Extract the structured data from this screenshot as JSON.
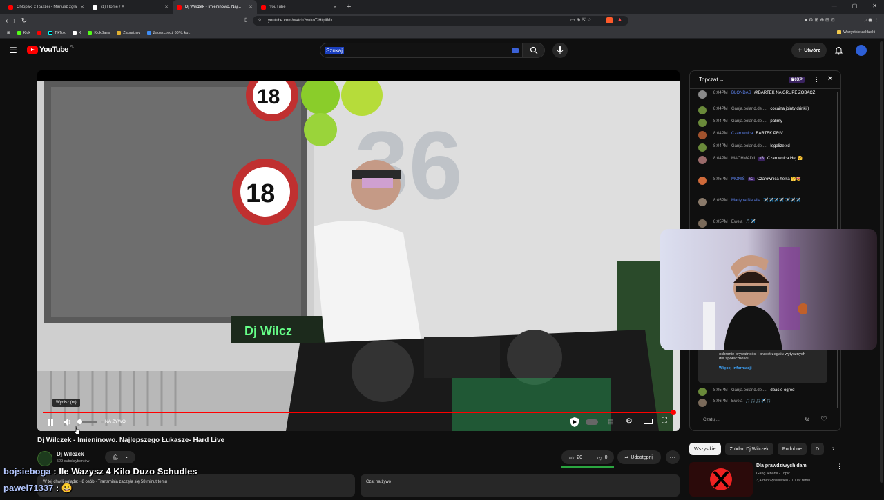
{
  "browser": {
    "tabs": [
      {
        "title": "Chłopaki z Raszei - Mariusz zgłasza ...",
        "fav": "#ff0000",
        "active": false
      },
      {
        "title": "(1) Home / X",
        "fav": "#ffffff",
        "active": false
      },
      {
        "title": "Dj Wilczek - Imieninowo. Naj...",
        "fav": "#ff0000",
        "active": true
      },
      {
        "title": "YouTube",
        "fav": "#ff0000",
        "active": false
      }
    ],
    "url": "youtube.com/watch?v=koT-HtplIMk",
    "bookmarks": [
      "Kick",
      "",
      "TikTok",
      "X",
      "KickBans",
      "Zagraj.my",
      "Zaoszczędź 60%, ku...",
      "Wszystkie zakładki"
    ]
  },
  "youtube": {
    "logo_text": "YouTube",
    "logo_region": "PL",
    "search_value": "Szukaj",
    "create_label": "Utwórz"
  },
  "player": {
    "live_label": "NA ŻYWO",
    "tooltip": "Wycisz (m)",
    "progress_fraction": 1.0
  },
  "video": {
    "title": "Dj Wilczek - Imieninowo. Najlepszego Łukasze- Hard Live",
    "channel": "Dj Wilczek",
    "subscribers": "529 subskrybentów",
    "likes": "20",
    "dislikes": "0",
    "share_label": "Udostępnij",
    "desc_left": "W tej chwili ogląda: ~8 osób · Transmisja zaczęła się 58 minut temu",
    "desc_right": "Czat na żywo"
  },
  "overlay": {
    "line1_user": "bojsieboga",
    "line1_text": ": Ile Wazysz 4 Kilo Duzo Schudles",
    "line2_user": "pawel71337",
    "line2_text": ":"
  },
  "chat": {
    "title": "Topczat",
    "xp": "0XP",
    "messages": [
      {
        "time": "8:04PM",
        "name": "BLONDAS",
        "text": "@BARTEK NA GRUPE ZOBACZ",
        "blue": true,
        "av": "#8a8a8a"
      },
      {
        "time": "8:04PM",
        "name": "Ganja.poland.de.....",
        "text": "cocaina jointy drinki:)",
        "blue": false,
        "av": "#6a8a3a"
      },
      {
        "time": "8:04PM",
        "name": "Ganja.poland.de.....",
        "text": "palimy",
        "blue": false,
        "av": "#6a8a3a"
      },
      {
        "time": "8:04PM",
        "name": "Czarownica",
        "text": "BARTEK PRIV",
        "blue": true,
        "av": "#a0522d"
      },
      {
        "time": "8:04PM",
        "name": "Ganja.poland.de.....",
        "text": "legalize xd",
        "blue": false,
        "av": "#6a8a3a"
      },
      {
        "time": "8:04PM",
        "name": "MACHMADII",
        "chip": "#3",
        "text": "Czarownica Hej 🤗",
        "blue": false,
        "av": "#9a6a6a"
      },
      {
        "time": "8:05PM",
        "name": "MONIŚ",
        "chip": "#2",
        "text": "Czarownica hejka 🤗😻",
        "blue": true,
        "av": "#d06a3a"
      },
      {
        "time": "8:05PM",
        "name": "Martyna Natalia",
        "text": "✈️✈️✈️✈️ ✈️✈️✈️",
        "blue": true,
        "av": "#8a7a6a"
      },
      {
        "time": "8:05PM",
        "name": "Ewela",
        "text": "🎵✈️",
        "blue": false,
        "av": "#7a6a5a"
      },
      {
        "time": "8:05PM",
        "name": "Ganja.poland.de.....",
        "text": "dbać o ogród",
        "blue": false,
        "av": "#6a8a3a"
      },
      {
        "time": "8:06PM",
        "name": "Ewela",
        "text": "🎵🎵🎵✈️🎵",
        "blue": false,
        "av": "#7a6a5a"
      }
    ],
    "info_text": "ochronie prywatności i przestrzegaiu wytycznych dla społeczności.",
    "info_link": "Więcej informacji",
    "input_placeholder": "Czatuj..."
  },
  "related": {
    "chips": [
      "Wszystkie",
      "Źródło: Dj Wilczek",
      "Podobne",
      "D"
    ],
    "title": "Dla prawdziwych dam",
    "channel": "Gang Albanii - Topic",
    "meta": "3,4 mln wyświetleń · 10 lat temu"
  },
  "colors": {
    "brand_red": "#ff0000",
    "link_blue": "#3ea6ff",
    "like_green": "#2ba640"
  }
}
